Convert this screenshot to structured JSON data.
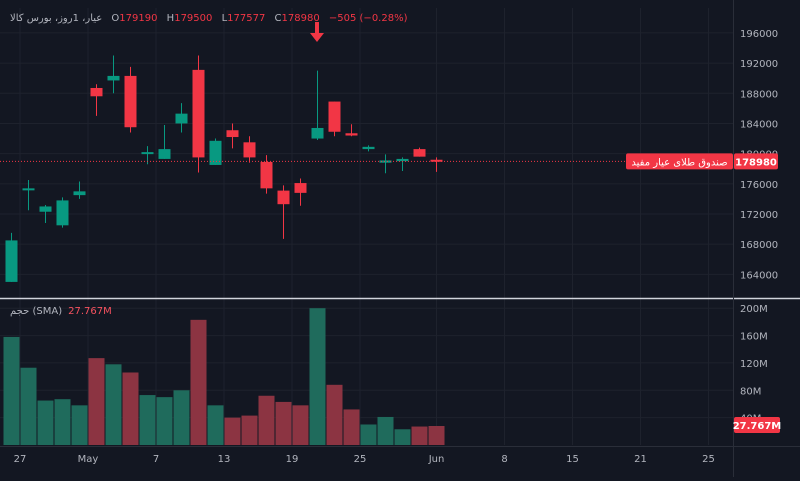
{
  "legend": {
    "symbol": "عیار، 1روز، بورس کالا",
    "o_label": "O",
    "o_value": "179190",
    "h_label": "H",
    "h_value": "179500",
    "l_label": "L",
    "l_value": "177577",
    "c_label": "C",
    "c_value": "178980",
    "change": "−505 (−0.28%)"
  },
  "volume_legend": {
    "label": "حجم (SMA)",
    "value": "27.767M"
  },
  "price_label": {
    "name": "صندوق طلای عیار مفید",
    "value": "178980"
  },
  "volume_price_label": "27.767M",
  "colors": {
    "background": "#131722",
    "up": "#089981",
    "down": "#f23645",
    "up_volume": "#1f6b5c",
    "down_volume": "#8c3442",
    "grid": "#1e222d",
    "text": "#b2b5be"
  },
  "chart_data": {
    "type": "candlestick",
    "price_axis": {
      "ticks": [
        164000,
        168000,
        172000,
        176000,
        180000,
        184000,
        188000,
        192000,
        196000
      ],
      "tick_labels": [
        "164000",
        "168000",
        "172000",
        "176000",
        "180000",
        "184000",
        "188000",
        "192000",
        "196000"
      ],
      "range": [
        161000,
        199300
      ]
    },
    "volume_axis": {
      "ticks": [
        40,
        80,
        120,
        160,
        200
      ],
      "tick_labels": [
        "40M",
        "80M",
        "120M",
        "160M",
        "200M"
      ],
      "range": [
        0,
        212
      ],
      "unit": "M"
    },
    "time_axis": {
      "tick_labels": [
        "27",
        "May",
        "7",
        "13",
        "19",
        "25",
        "Jun",
        "8",
        "15",
        "21",
        "25"
      ],
      "tick_slots": [
        0.5,
        4.5,
        8.5,
        12.5,
        16.5,
        20.5,
        25,
        29,
        33,
        37,
        41
      ]
    },
    "candles": [
      {
        "slot": 0,
        "o": 163000,
        "h": 169500,
        "l": 163000,
        "c": 168500,
        "vol": 158
      },
      {
        "slot": 1,
        "o": 175200,
        "h": 176500,
        "l": 172500,
        "c": 175400,
        "vol": 113
      },
      {
        "slot": 2,
        "o": 172300,
        "h": 173200,
        "l": 170800,
        "c": 173000,
        "vol": 65
      },
      {
        "slot": 3,
        "o": 170500,
        "h": 174200,
        "l": 170200,
        "c": 173800,
        "vol": 67
      },
      {
        "slot": 4,
        "o": 174500,
        "h": 176300,
        "l": 174000,
        "c": 175000,
        "vol": 58
      },
      {
        "slot": 5,
        "o": 188700,
        "h": 189200,
        "l": 185000,
        "c": 187600,
        "vol": 127
      },
      {
        "slot": 6,
        "o": 189700,
        "h": 193000,
        "l": 188000,
        "c": 190300,
        "vol": 118
      },
      {
        "slot": 7,
        "o": 190300,
        "h": 191500,
        "l": 182800,
        "c": 183500,
        "vol": 106
      },
      {
        "slot": 8,
        "o": 180200,
        "h": 181000,
        "l": 178600,
        "c": 180200,
        "vol": 73
      },
      {
        "slot": 9,
        "o": 179300,
        "h": 183800,
        "l": 179300,
        "c": 180600,
        "vol": 70
      },
      {
        "slot": 10,
        "o": 184000,
        "h": 186700,
        "l": 182800,
        "c": 185300,
        "vol": 80
      },
      {
        "slot": 11,
        "o": 191100,
        "h": 193000,
        "l": 177500,
        "c": 179500,
        "vol": 183
      },
      {
        "slot": 12,
        "o": 178500,
        "h": 182000,
        "l": 178500,
        "c": 181700,
        "vol": 58
      },
      {
        "slot": 13,
        "o": 183100,
        "h": 184000,
        "l": 180700,
        "c": 182200,
        "vol": 40
      },
      {
        "slot": 14,
        "o": 181500,
        "h": 182300,
        "l": 178800,
        "c": 179500,
        "vol": 43
      },
      {
        "slot": 15,
        "o": 178900,
        "h": 179800,
        "l": 174700,
        "c": 175400,
        "vol": 72
      },
      {
        "slot": 16,
        "o": 175100,
        "h": 175800,
        "l": 168700,
        "c": 173300,
        "vol": 63
      },
      {
        "slot": 17,
        "o": 176100,
        "h": 176700,
        "l": 173100,
        "c": 174800,
        "vol": 58
      },
      {
        "slot": 18,
        "o": 182000,
        "h": 191000,
        "l": 181800,
        "c": 183400,
        "vol": 200
      },
      {
        "slot": 19,
        "o": 186900,
        "h": 186900,
        "l": 182300,
        "c": 182900,
        "vol": 88
      },
      {
        "slot": 20,
        "o": 182700,
        "h": 183900,
        "l": 182300,
        "c": 182400,
        "vol": 52
      },
      {
        "slot": 21,
        "o": 180600,
        "h": 181100,
        "l": 180300,
        "c": 180900,
        "vol": 30
      },
      {
        "slot": 22,
        "o": 178800,
        "h": 179900,
        "l": 177400,
        "c": 179100,
        "vol": 41
      },
      {
        "slot": 23,
        "o": 179000,
        "h": 179500,
        "l": 177700,
        "c": 179300,
        "vol": 23
      },
      {
        "slot": 24,
        "o": 180600,
        "h": 180800,
        "l": 179600,
        "c": 179600,
        "vol": 27
      },
      {
        "slot": 25,
        "o": 179190,
        "h": 179500,
        "l": 177577,
        "c": 178980,
        "vol": 27.767
      }
    ]
  }
}
